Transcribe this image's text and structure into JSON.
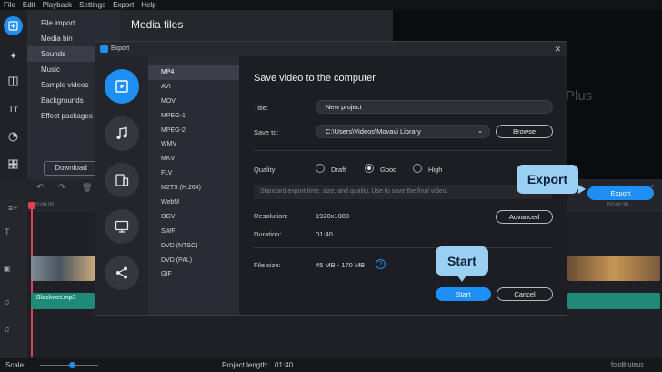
{
  "menu": [
    "File",
    "Edit",
    "Playback",
    "Settings",
    "Export",
    "Help"
  ],
  "sidebar": {
    "items": [
      "File import",
      "Media bin",
      "Sounds",
      "Music",
      "Sample videos",
      "Backgrounds",
      "Effect packages"
    ],
    "selected_index": 2,
    "download_label": "Download"
  },
  "media": {
    "title": "Media files"
  },
  "preview": {
    "watermark": "Plus"
  },
  "timeline": {
    "ruler_start": "00:00:00",
    "ruler_end": "00:00:35",
    "audio_clip_label": "Blackwet.mp3",
    "export_button": "Export"
  },
  "status": {
    "scale_label": "Scale:",
    "project_length_label": "Project length:",
    "project_length_value": "01:40",
    "brand": "fotoBruteus"
  },
  "dialog": {
    "window_title": "Export",
    "formats": [
      "MP4",
      "AVI",
      "MOV",
      "MPEG-1",
      "MPEG-2",
      "WMV",
      "MKV",
      "FLV",
      "M2TS (H.264)",
      "WebM",
      "OGV",
      "SWF",
      "DVD (NTSC)",
      "DVD (PAL)",
      "GIF"
    ],
    "selected_format_index": 0,
    "heading": "Save video to the computer",
    "title_label": "Title:",
    "title_value": "New project",
    "save_to_label": "Save to:",
    "save_to_value": "C:\\Users\\Videos\\Movavi Library",
    "browse_label": "Browse",
    "quality_label": "Quality:",
    "quality_options": [
      "Draft",
      "Good",
      "High"
    ],
    "quality_selected": "Good",
    "hint": "Standard export time, size, and quality. Use to save the final video.",
    "resolution_label": "Resolution:",
    "resolution_value": "1920x1080",
    "advanced_label": "Advanced",
    "duration_label": "Duration:",
    "duration_value": "01:40",
    "file_size_label": "File size:",
    "file_size_value": "45 MB - 170 MB",
    "start_label": "Start",
    "cancel_label": "Cancel"
  },
  "callouts": {
    "export": "Export",
    "start": "Start"
  },
  "colors": {
    "accent": "#1d8ff5",
    "callout": "#9bd0f5"
  }
}
